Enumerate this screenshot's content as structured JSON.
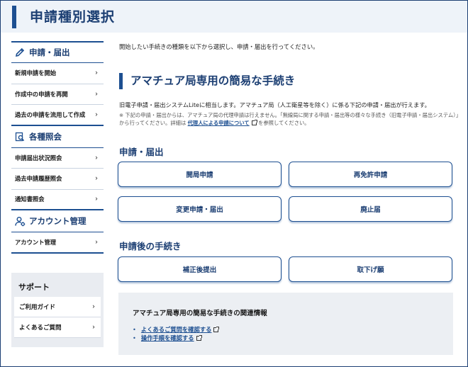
{
  "header": {
    "title": "申請種別選択"
  },
  "sidebar": {
    "sections": [
      {
        "title": "申請・届出",
        "icon": "pencil-icon",
        "items": [
          "新規申請を開始",
          "作成中の申請を再開",
          "過去の申請を流用して作成"
        ]
      },
      {
        "title": "各種照会",
        "icon": "search-document-icon",
        "items": [
          "申請届出状況照会",
          "過去申請履歴照会",
          "通知書照会"
        ]
      },
      {
        "title": "アカウント管理",
        "icon": "user-gear-icon",
        "items": [
          "アカウント管理"
        ]
      }
    ],
    "support": {
      "title": "サポート",
      "items": [
        "ご利用ガイド",
        "よくあるご質問"
      ]
    }
  },
  "main": {
    "intro": "開始したい手続きの種類を以下から選択し、申請・届出を行ってください。",
    "title": "アマチュア局専用の簡易な手続き",
    "description": "旧電子申請・届出システムLiteに相当します。アマチュア局（人工衛星等を除く）に係る下記の申請・届出が行えます。",
    "note_before": "※ 下記の申請・届出からは、アマチュア局の代理申請は行えません。「無線局に関する申請・届出等の様々な手続き（旧電子申請・届出システム）」から行ってください。詳細は",
    "note_link": "代理人による申請について",
    "note_after": "を参照してください。",
    "group1": {
      "title": "申請・届出",
      "buttons": [
        "開局申請",
        "再免許申請",
        "変更申請・届出",
        "廃止届"
      ]
    },
    "group2": {
      "title": "申請後の手続き",
      "buttons": [
        "補正後提出",
        "取下げ願"
      ]
    },
    "related": {
      "title": "アマチュア局専用の簡易な手続きの関連情報",
      "links": [
        "よくあるご質問を確認する",
        "操作手順を確認する"
      ]
    }
  }
}
